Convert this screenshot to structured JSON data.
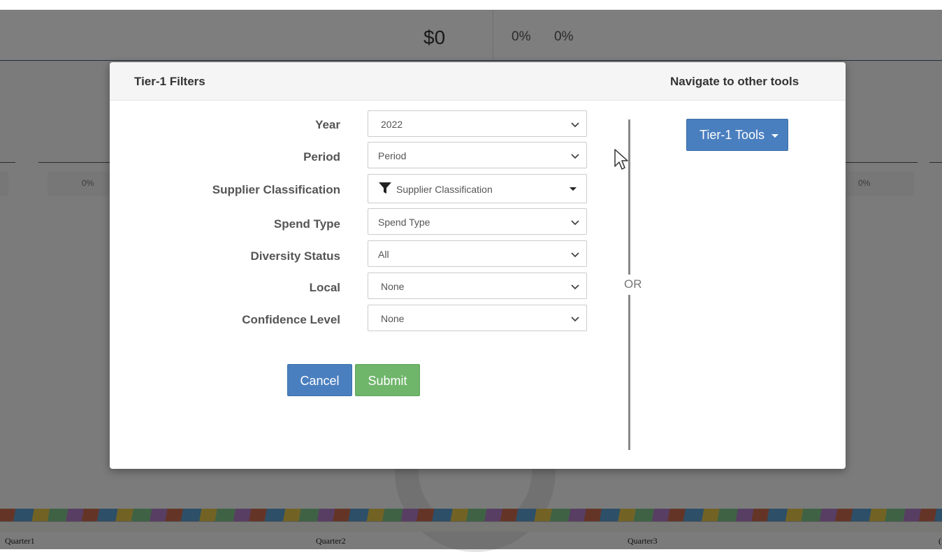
{
  "background": {
    "total_spend": "$0",
    "pct_a": "0%",
    "pct_b": "0%",
    "side_pct_left": "0%",
    "side_pct_right": "0%",
    "quarters": [
      "Quarter1",
      "Quarter2",
      "Quarter3",
      "("
    ]
  },
  "modal": {
    "title": "Tier-1 Filters",
    "nav_title": "Navigate to other tools",
    "or_label": "OR",
    "filters": [
      {
        "label": "Year",
        "value": "2022",
        "control": "chevron"
      },
      {
        "label": "Period",
        "value": "Period",
        "control": "chevron"
      },
      {
        "label": "Supplier Classification",
        "value": "Supplier Classification",
        "control": "caret",
        "icon": "filter-icon"
      },
      {
        "label": "Spend Type",
        "value": "Spend Type",
        "control": "chevron"
      },
      {
        "label": "Diversity Status",
        "value": "All",
        "control": "chevron"
      },
      {
        "label": "Local",
        "value": "None",
        "control": "chevron"
      },
      {
        "label": "Confidence Level",
        "value": "None",
        "control": "chevron"
      }
    ],
    "buttons": {
      "cancel": "Cancel",
      "submit": "Submit"
    },
    "tools_button": "Tier-1 Tools"
  },
  "colors": {
    "primary": "#4a7fbf",
    "success": "#6fb56a",
    "overlay": "rgba(0,0,0,0.5)"
  }
}
